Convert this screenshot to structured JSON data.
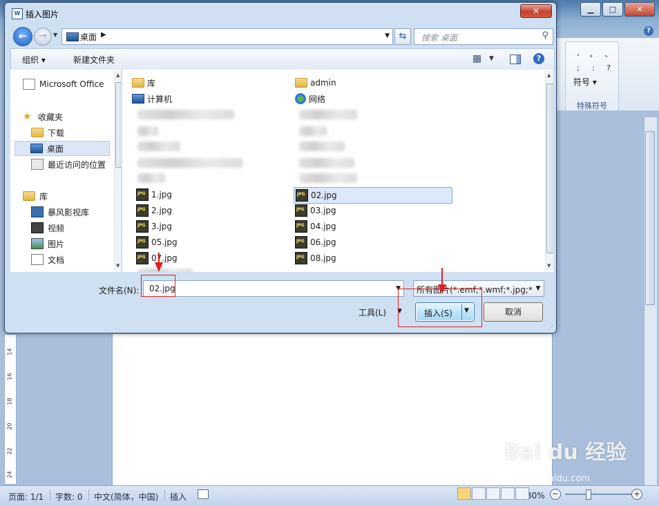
{
  "dialog": {
    "title": "插入图片",
    "close_icon": "close-icon"
  },
  "navigation": {
    "address": "桌面",
    "search_placeholder": "搜索 桌面"
  },
  "toolbar": {
    "organize_label": "组织 ▾",
    "new_folder_label": "新建文件夹"
  },
  "nav_pane": {
    "items": [
      {
        "label": "Microsoft Office",
        "icon": "word-icon"
      },
      {
        "label": "收藏夹",
        "icon": "star-icon"
      },
      {
        "label": "下载",
        "icon": "download-icon"
      },
      {
        "label": "桌面",
        "icon": "desktop-icon",
        "selected": true
      },
      {
        "label": "最近访问的位置",
        "icon": "recent-icon"
      },
      {
        "label": "库",
        "icon": "library-icon"
      },
      {
        "label": "暴风影视库",
        "icon": "video-library-icon"
      },
      {
        "label": "视频",
        "icon": "video-icon"
      },
      {
        "label": "图片",
        "icon": "pictures-icon"
      },
      {
        "label": "文档",
        "icon": "documents-icon"
      }
    ]
  },
  "files": {
    "left_column": [
      {
        "name": "库",
        "type": "folder"
      },
      {
        "name": "计算机",
        "type": "computer"
      },
      {
        "name": "1.jpg",
        "type": "jpg"
      },
      {
        "name": "2.jpg",
        "type": "jpg"
      },
      {
        "name": "3.jpg",
        "type": "jpg"
      },
      {
        "name": "05.jpg",
        "type": "jpg"
      },
      {
        "name": "07.jpg",
        "type": "jpg"
      }
    ],
    "right_column": [
      {
        "name": "admin",
        "type": "folder"
      },
      {
        "name": "网络",
        "type": "network"
      },
      {
        "name": "02.jpg",
        "type": "jpg",
        "selected": true
      },
      {
        "name": "03.jpg",
        "type": "jpg"
      },
      {
        "name": "04.jpg",
        "type": "jpg"
      },
      {
        "name": "06.jpg",
        "type": "jpg"
      },
      {
        "name": "08.jpg",
        "type": "jpg"
      }
    ]
  },
  "bottom": {
    "filename_label": "文件名(N):",
    "filename_value": "02.jpg",
    "filetype_value": "所有图片(*.emf;*.wmf;*.jpg;*.jpeg",
    "tools_label": "工具(L)",
    "insert_label": "插入(S)",
    "cancel_label": "取消"
  },
  "word": {
    "symbols": [
      ",",
      "。",
      "、",
      ";",
      ":",
      "?"
    ],
    "symbol_button": "符号 ▾",
    "special_symbols_label": "特殊符号",
    "ruler_marks": [
      "14",
      "16",
      "18",
      "20",
      "22",
      "24"
    ]
  },
  "statusbar": {
    "page": "页面: 1/1",
    "words": "字数: 0",
    "language": "中文(简体，中国)",
    "mode": "插入",
    "zoom": "80%"
  },
  "watermark": {
    "text": "Bai du 经验",
    "sub": "jingyan.baidu.com"
  },
  "colors": {
    "annotation": "#e02020",
    "selection": "#dce9f9"
  }
}
